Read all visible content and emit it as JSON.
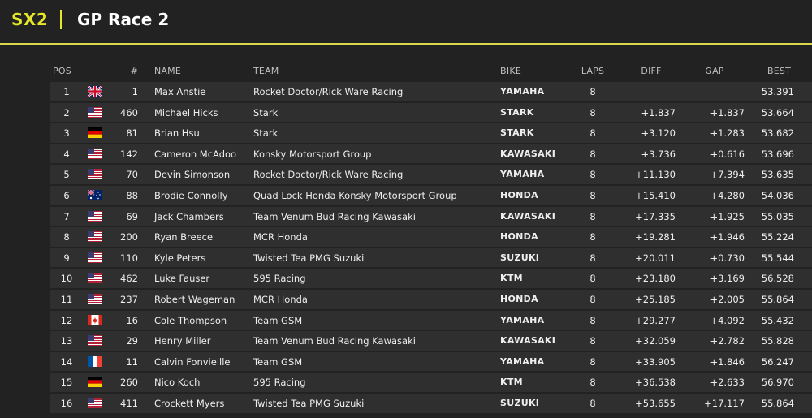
{
  "header": {
    "brand": "SX2",
    "title": "GP Race 2"
  },
  "columns": {
    "pos": "POS",
    "num": "#",
    "name": "NAME",
    "team": "TEAM",
    "bike": "BIKE",
    "laps": "LAPS",
    "diff": "DIFF",
    "gap": "GAP",
    "best": "BEST"
  },
  "rows": [
    {
      "pos": "1",
      "flag": "gb",
      "num": "1",
      "name": "Max Anstie",
      "team": "Rocket Doctor/Rick Ware Racing",
      "bike": "YAMAHA",
      "laps": "8",
      "diff": "",
      "gap": "",
      "best": "53.391"
    },
    {
      "pos": "2",
      "flag": "us",
      "num": "460",
      "name": "Michael Hicks",
      "team": "Stark",
      "bike": "STARK",
      "laps": "8",
      "diff": "+1.837",
      "gap": "+1.837",
      "best": "53.664"
    },
    {
      "pos": "3",
      "flag": "de",
      "num": "81",
      "name": "Brian Hsu",
      "team": "Stark",
      "bike": "STARK",
      "laps": "8",
      "diff": "+3.120",
      "gap": "+1.283",
      "best": "53.682"
    },
    {
      "pos": "4",
      "flag": "us",
      "num": "142",
      "name": "Cameron McAdoo",
      "team": "Konsky Motorsport Group",
      "bike": "KAWASAKI",
      "laps": "8",
      "diff": "+3.736",
      "gap": "+0.616",
      "best": "53.696"
    },
    {
      "pos": "5",
      "flag": "us",
      "num": "70",
      "name": "Devin Simonson",
      "team": "Rocket Doctor/Rick Ware Racing",
      "bike": "YAMAHA",
      "laps": "8",
      "diff": "+11.130",
      "gap": "+7.394",
      "best": "53.635"
    },
    {
      "pos": "6",
      "flag": "au",
      "num": "88",
      "name": "Brodie Connolly",
      "team": "Quad Lock Honda Konsky Motorsport Group",
      "bike": "HONDA",
      "laps": "8",
      "diff": "+15.410",
      "gap": "+4.280",
      "best": "54.036"
    },
    {
      "pos": "7",
      "flag": "us",
      "num": "69",
      "name": "Jack Chambers",
      "team": "Team Venum Bud Racing Kawasaki",
      "bike": "KAWASAKI",
      "laps": "8",
      "diff": "+17.335",
      "gap": "+1.925",
      "best": "55.035"
    },
    {
      "pos": "8",
      "flag": "us",
      "num": "200",
      "name": "Ryan Breece",
      "team": "MCR Honda",
      "bike": "HONDA",
      "laps": "8",
      "diff": "+19.281",
      "gap": "+1.946",
      "best": "55.224"
    },
    {
      "pos": "9",
      "flag": "us",
      "num": "110",
      "name": "Kyle Peters",
      "team": "Twisted Tea PMG Suzuki",
      "bike": "SUZUKI",
      "laps": "8",
      "diff": "+20.011",
      "gap": "+0.730",
      "best": "55.544"
    },
    {
      "pos": "10",
      "flag": "us",
      "num": "462",
      "name": "Luke Fauser",
      "team": "595 Racing",
      "bike": "KTM",
      "laps": "8",
      "diff": "+23.180",
      "gap": "+3.169",
      "best": "56.528"
    },
    {
      "pos": "11",
      "flag": "us",
      "num": "237",
      "name": "Robert Wageman",
      "team": "MCR Honda",
      "bike": "HONDA",
      "laps": "8",
      "diff": "+25.185",
      "gap": "+2.005",
      "best": "55.864"
    },
    {
      "pos": "12",
      "flag": "ca",
      "num": "16",
      "name": "Cole Thompson",
      "team": "Team GSM",
      "bike": "YAMAHA",
      "laps": "8",
      "diff": "+29.277",
      "gap": "+4.092",
      "best": "55.432"
    },
    {
      "pos": "13",
      "flag": "us",
      "num": "29",
      "name": "Henry Miller",
      "team": "Team Venum Bud Racing Kawasaki",
      "bike": "KAWASAKI",
      "laps": "8",
      "diff": "+32.059",
      "gap": "+2.782",
      "best": "55.828"
    },
    {
      "pos": "14",
      "flag": "fr",
      "num": "11",
      "name": "Calvin Fonvieille",
      "team": "Team GSM",
      "bike": "YAMAHA",
      "laps": "8",
      "diff": "+33.905",
      "gap": "+1.846",
      "best": "56.247"
    },
    {
      "pos": "15",
      "flag": "de",
      "num": "260",
      "name": "Nico Koch",
      "team": "595 Racing",
      "bike": "KTM",
      "laps": "8",
      "diff": "+36.538",
      "gap": "+2.633",
      "best": "56.970"
    },
    {
      "pos": "16",
      "flag": "us",
      "num": "411",
      "name": "Crockett Myers",
      "team": "Twisted Tea PMG Suzuki",
      "bike": "SUZUKI",
      "laps": "8",
      "diff": "+53.655",
      "gap": "+17.117",
      "best": "55.864"
    }
  ]
}
